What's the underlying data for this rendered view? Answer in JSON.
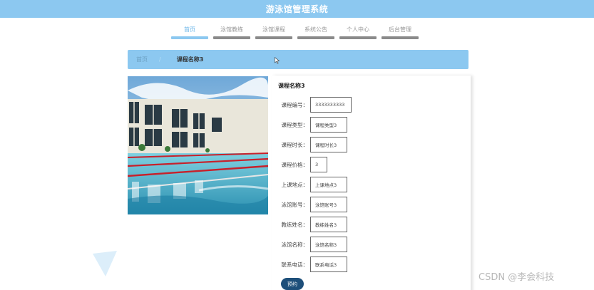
{
  "header": {
    "title": "游泳馆管理系统"
  },
  "nav": {
    "items": [
      {
        "label": "首页",
        "active": true
      },
      {
        "label": "泳馆教练",
        "active": false
      },
      {
        "label": "泳馆课程",
        "active": false
      },
      {
        "label": "系统公告",
        "active": false
      },
      {
        "label": "个人中心",
        "active": false
      },
      {
        "label": "后台管理",
        "active": false
      }
    ]
  },
  "breadcrumb": {
    "home": "首页",
    "separator": "/",
    "current": "课程名称3"
  },
  "detail": {
    "name": "课程名称3",
    "fields": [
      {
        "label": "课程编号：",
        "value": "3333333333"
      },
      {
        "label": "课程类型：",
        "value": "课程类型3"
      },
      {
        "label": "课程时长：",
        "value": "课程时长3"
      },
      {
        "label": "课程价格：",
        "value": "3"
      },
      {
        "label": "上课地点：",
        "value": "上课地点3"
      },
      {
        "label": "泳馆账号：",
        "value": "泳馆账号3"
      },
      {
        "label": "教练姓名：",
        "value": "教练姓名3"
      },
      {
        "label": "泳馆名称：",
        "value": "泳馆名称3"
      },
      {
        "label": "联系电话：",
        "value": "联系电话3"
      }
    ],
    "book_label": "预约"
  },
  "watermark": "CSDN @李会科技",
  "colors": {
    "primary": "#8cc8f0",
    "button": "#1e4f7a"
  }
}
